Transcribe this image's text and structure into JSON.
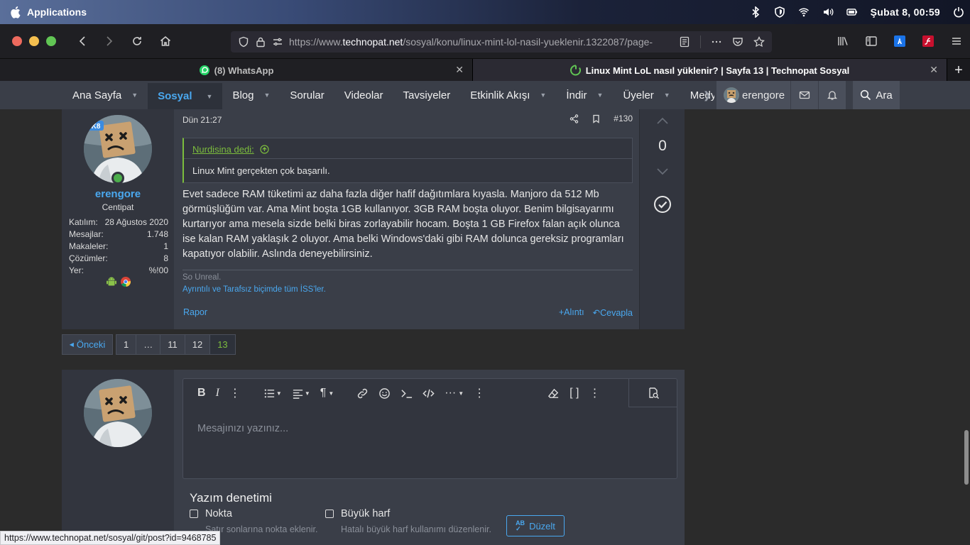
{
  "system": {
    "apps_label": "Applications",
    "clock": "Şubat  8, 00:59"
  },
  "browser": {
    "url_prefix": "https://www.",
    "url_domain": "technopat.net",
    "url_path": "/sosyal/konu/linux-mint-lol-nasil-yueklenir.1322087/page-",
    "tabs": [
      {
        "label": "(8) WhatsApp",
        "icon": "whatsapp-icon"
      },
      {
        "label": "Linux Mint LoL nasıl yüklenir? | Sayfa 13 | Technopat Sosyal",
        "icon": "loading-icon"
      }
    ]
  },
  "nav": {
    "items": [
      {
        "label": "Ana Sayfa",
        "caret": true
      },
      {
        "label": "Sosyal",
        "caret": true,
        "active": true
      },
      {
        "label": "Blog",
        "caret": true
      },
      {
        "label": "Sorular",
        "caret": false
      },
      {
        "label": "Videolar",
        "caret": false
      },
      {
        "label": "Tavsiyeler",
        "caret": false
      },
      {
        "label": "Etkinlik Akışı",
        "caret": true
      },
      {
        "label": "İndir",
        "caret": true
      },
      {
        "label": "Üyeler",
        "caret": true
      },
      {
        "label": "Medya",
        "caret": false
      }
    ],
    "user": "erengore",
    "search": "Ara"
  },
  "post": {
    "username": "erengore",
    "user_title": "Centipat",
    "avatar_badge": "K8",
    "stats": [
      {
        "label": "Katılım:",
        "value": "28 Ağustos 2020"
      },
      {
        "label": "Mesajlar:",
        "value": "1.748"
      },
      {
        "label": "Makaleler:",
        "value": "1"
      },
      {
        "label": "Çözümler:",
        "value": "8"
      },
      {
        "label": "Yer:",
        "value": "%!00"
      }
    ],
    "date": "Dün 21:27",
    "number": "#130",
    "quote_author": "Nurdisina dedi:",
    "quote_text": "Linux Mint gerçekten çok başarılı.",
    "body": "Evet sadece RAM tüketimi az daha fazla diğer hafif dağıtımlara kıyasla. Manjoro da 512 Mb görmüşlüğüm var. Ama Mint boşta 1GB kullanıyor. 3GB RAM boşta oluyor. Benim bilgisayarımı kurtarıyor ama mesela sizde belki biras zorlayabilir hocam. Boşta 1 GB Firefox falan açık olunca ise kalan RAM yaklaşık 2 oluyor. Ama belki Windows'daki gibi RAM dolunca gereksiz programları kapatıyor olabilir. Aslında deneyebilirsiniz.",
    "signature_1": "So Unreal.",
    "signature_2": "Ayrıntılı ve Tarafsız biçimde tüm İSS'ler.",
    "report": "Rapor",
    "quote_action": "Alıntı",
    "reply_action": "Cevapla",
    "vote_count": "0"
  },
  "pager": {
    "prev": "Önceki",
    "pages": [
      "1",
      "…",
      "11",
      "12",
      "13"
    ],
    "current": "13"
  },
  "reply": {
    "placeholder": "Mesajınızı yazınız...",
    "spell_title": "Yazım denetimi",
    "opt1_label": "Nokta",
    "opt1_hint": "Satır sonlarına nokta eklenir.",
    "opt2_label": "Büyük harf",
    "opt2_hint": "Hatalı büyük harf kullanımı düzenlenir.",
    "fix_label": "Düzelt",
    "fix_icon_text": "AB"
  },
  "status_url": "https://www.technopat.net/sosyal/git/post?id=9468785",
  "colors": {
    "accent": "#4aa8ef",
    "green": "#7cbd3d",
    "panel": "#3a3e48"
  }
}
